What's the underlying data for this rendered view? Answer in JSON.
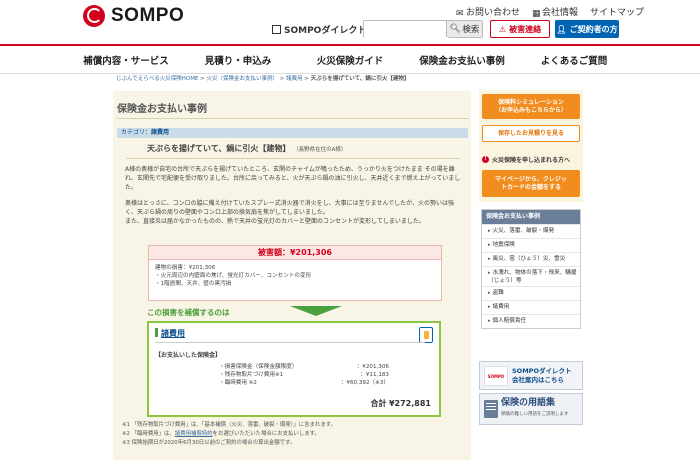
{
  "header": {
    "brand": "SOMPO",
    "top_links": [
      "お問い合わせ",
      "会社情報",
      "サイトマップ"
    ],
    "sompo_direct": "SOMPOダイレクト",
    "search_placeholder": "",
    "search_button": "検索",
    "damage_button": "被害連絡",
    "contract_button": "ご契約者の方"
  },
  "nav": [
    "補償内容・サービス",
    "見積り・申込み",
    "火災保険ガイド",
    "保険金お支払い事例",
    "よくあるご質問"
  ],
  "breadcrumb": {
    "items": [
      "じぶんでえらべる火災保険HOME",
      "火災（保険金お支払い事例）",
      "諸費用"
    ],
    "current": "天ぷらを揚げていて、鍋に引火【建物】"
  },
  "main": {
    "page_title": "保険金お支払い事例",
    "category_label": "カテゴリ：",
    "category": "諸費用",
    "case_title": "天ぷらを揚げていて、鍋に引火【建物】",
    "case_sub": "（長野県在住のA様）",
    "para1": "A様の奥様が自宅の台所で天ぷらを揚げていたところ、玄関のチャイムが鳴ったため、うっかり火をつけたまま その場を離れ、玄関先で宅配便を受け取りました。台所に戻ってみると、火が天ぷら鍋の油に引火し、天井近くまで燃え上がっていました。",
    "para2": "奥様はとっさに、コンロの脇に備え付けていたスプレー式消火器で消火をし、大事には至りませんでしたが、火の勢いは強く、天ぷら鍋の周りの壁面やコンロ上部の換気扇を焦がしてしまいました。\nまた、直接炎は届かなかったものの、熱で天井の蛍光灯のカバーと壁面のコンセントが変形してしまいました。",
    "damage": {
      "head": "被害額：¥201,306",
      "lines": [
        "建物の損害：¥201,306",
        "・火元周辺の内壁面の焦げ、蛍光灯カバー、コンセントの変形",
        "・1階居間、天井、壁の黒汚損"
      ]
    },
    "cover_title": "この損害を補償するのは",
    "item_title": "諸費用",
    "pay_title": "【お支払いした保険金】",
    "pay_rows": [
      {
        "label": "・損害保険金（保険金額限度）",
        "value": "：¥201,306"
      },
      {
        "label": "・残存物取片づけ費用※1",
        "value": "：¥11,183"
      },
      {
        "label": "・臨時費用 ※2",
        "value": "：¥60,392（※3）"
      }
    ],
    "total_label": "合計",
    "total_value": "¥272,881",
    "notes": [
      "※1 「残存物取片づけ費用」は、「基本補償（火災、落雷、破裂・爆発）」に含まれます。",
      "※2 「臨時費用」は、",
      "諸費用補償特約",
      "をお選びいただいた場合にお支払いします。",
      "※3 保険始期日が2020年6月30日以前のご契約の場合の算出金額です。"
    ]
  },
  "sidebar": {
    "sim_button": [
      "保険料シミュレーション",
      "（お申込みもこちらから）"
    ],
    "saved_button": "保存したお見積りを見る",
    "note": "火災保険を申し込まれる方へ",
    "card_button": [
      "マイページから、クレジッ",
      "トカードの金額をする"
    ],
    "menu_head": "保険金お支払い事例",
    "menu_items": [
      "火災、落雷、破裂・爆発",
      "地震保険",
      "風災、雹（ひょう）災、雪災",
      "水濡れ、物体の落下・飛来、騒擾（じょう）等",
      "盗難",
      "諸費用",
      "個人賠償責任"
    ],
    "banner1": [
      "SOMPOダイレクト",
      "会社案内はこちら"
    ],
    "banner1_logo": "SOMPO",
    "banner2": "保険の用語集",
    "banner2_sub": "保険の難しい用語をご説明します"
  }
}
